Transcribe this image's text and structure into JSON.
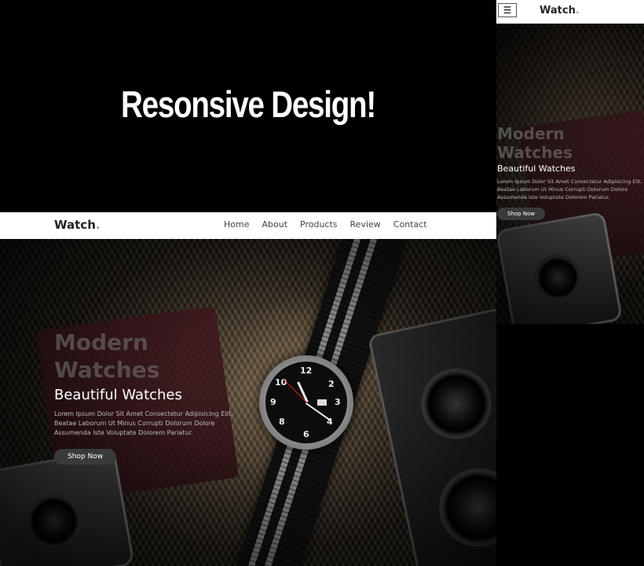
{
  "banner": {
    "title": "Resonsive Design!"
  },
  "desktop": {
    "logo": "Watch",
    "logo_dot": ".",
    "nav": [
      "Home",
      "About",
      "Products",
      "Review",
      "Contact"
    ],
    "hero": {
      "heading_line1": "Modern",
      "heading_line2": "Watches",
      "subheading": "Beautiful Watches",
      "body": "Lorem Ipsum Dolor Sit Amet Consectetur Adipisicing Elit. Beatae Laborum Ut Minus Corrupti Dolorum Dolore Assumenda Iste Voluptate Dolorem Pariatur.",
      "button": "Shop Now"
    },
    "watch_numbers": [
      "12",
      "2",
      "3",
      "4",
      "6",
      "8",
      "9",
      "10"
    ]
  },
  "mobile": {
    "menu_icon": "☰",
    "logo": "Watch",
    "logo_dot": ".",
    "hero": {
      "heading_line1": "Modern",
      "heading_line2": "Watches",
      "subheading": "Beautiful Watches",
      "body": "Lorem Ipsum Dolor Sit Amet Consectetur Adipisicing Elit. Beatae Laborum Ut Minus Corrupti Dolorum Dolore Assumenda Iste Voluptate Dolorem Pariatur.",
      "button": "Shop Now"
    }
  },
  "colors": {
    "nav_bg": "#ffffff",
    "button_bg": "#3a3a3a",
    "heading_muted": "#787878"
  }
}
